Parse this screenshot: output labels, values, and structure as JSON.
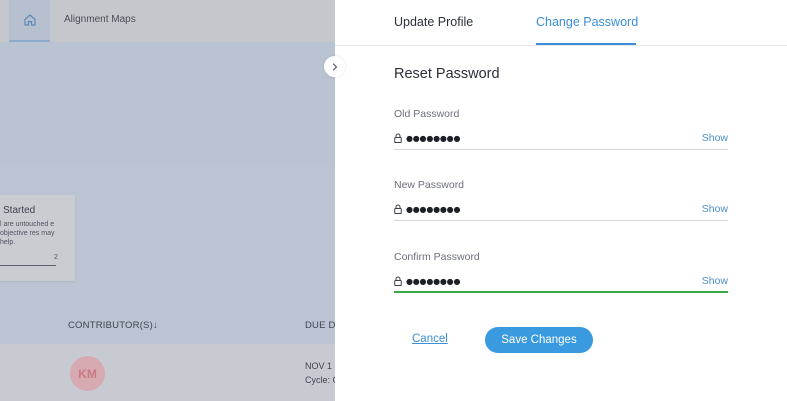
{
  "background": {
    "nav": {
      "home_icon": "home-icon",
      "tab_label": "Alignment Maps"
    },
    "card": {
      "title": "Started",
      "text": "l are untouched e objective res may help.",
      "count": "2"
    },
    "table": {
      "col_contributors": "CONTRIBUTOR(S)↓",
      "col_due": "DUE DA",
      "row": {
        "avatar_initials": "KM",
        "due_date": "NOV 1",
        "cycle": "Cycle: C"
      }
    }
  },
  "panel": {
    "collapse_icon": "chevron-right-icon",
    "tabs": [
      {
        "label": "Update Profile",
        "active": false
      },
      {
        "label": "Change Password",
        "active": true
      }
    ],
    "section_title": "Reset Password",
    "fields": [
      {
        "label": "Old Password",
        "value": "●●●●●●●●",
        "show_label": "Show",
        "icon": "lock-icon"
      },
      {
        "label": "New Password",
        "value": "●●●●●●●●",
        "show_label": "Show",
        "icon": "lock-icon"
      },
      {
        "label": "Confirm Password",
        "value": "●●●●●●●●",
        "show_label": "Show",
        "icon": "lock-icon",
        "focused": true
      }
    ],
    "actions": {
      "cancel_label": "Cancel",
      "save_label": "Save Changes"
    }
  },
  "colors": {
    "accent": "#3a8fd6",
    "save_button": "#3a9ae0",
    "focus_underline": "#3aa648",
    "overlay_background": "#bcc4d3"
  }
}
